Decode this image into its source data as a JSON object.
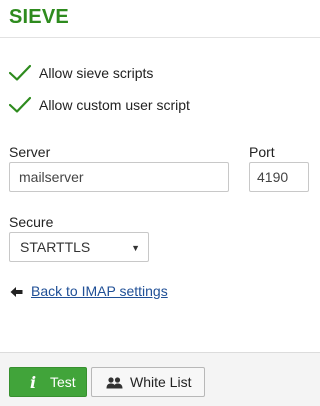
{
  "header": {
    "title": "SIEVE"
  },
  "options": [
    {
      "label": "Allow sieve scripts",
      "checked": true
    },
    {
      "label": "Allow custom user script",
      "checked": true
    }
  ],
  "server": {
    "label": "Server",
    "value": "mailserver"
  },
  "port": {
    "label": "Port",
    "value": "4190"
  },
  "secure": {
    "label": "Secure",
    "selected": "STARTTLS"
  },
  "back_link": {
    "label": "Back to IMAP settings"
  },
  "footer": {
    "test_label": "Test",
    "whitelist_label": "White List"
  },
  "colors": {
    "title": "#2e8b1e",
    "check": "#2e8b1e",
    "link": "#1f4f96",
    "test_button": "#41a43a"
  }
}
